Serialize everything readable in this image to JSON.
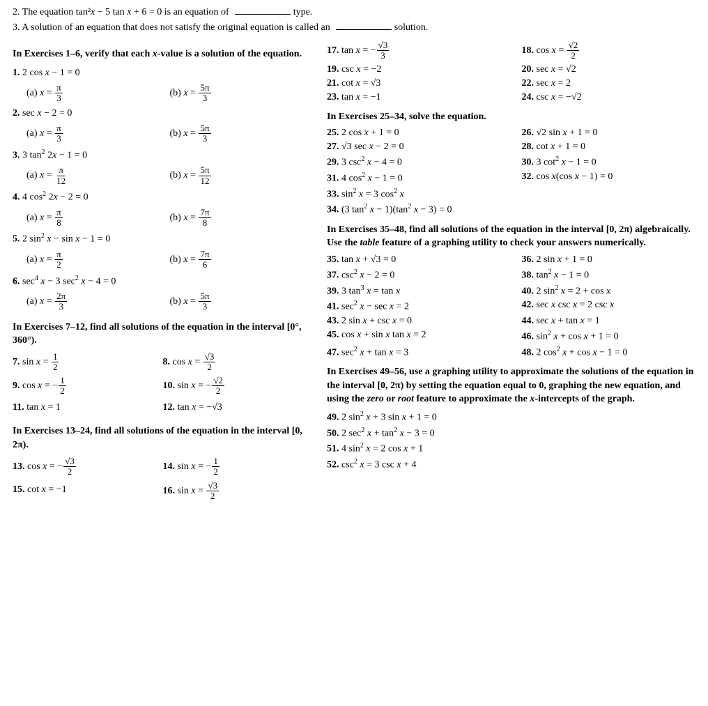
{
  "page": {
    "top": {
      "line2": "2. The equation tan²x − 5 tan x + 6 = 0 is an equation of",
      "line2_blank": "",
      "line2_type": "type.",
      "line3": "3. A solution of an equation that does not satisfy the original equation is called an",
      "line3_blank": "",
      "line3_end": "solution."
    },
    "sections": {
      "verify_header": "In Exercises 1–6, verify that each x-value is a solution of the equation.",
      "interval_7_12_header": "In Exercises 7–12, find all solutions of the equation in the interval [0°, 360°).",
      "interval_13_24_header": "In Exercises 13–24, find all solutions of the equation in the interval [0, 2π).",
      "right_17_24_header": "",
      "exercises_25_34_header": "In Exercises 25–34, solve the equation.",
      "exercises_35_48_header": "In Exercises 35–48, find all solutions of the equation in the interval [0, 2π) algebraically. Use the table feature of a graphing utility to check your answers numerically.",
      "exercises_49_56_header": "In Exercises 49–56, use a graphing utility to approximate the solutions of the equation in the interval [0, 2π) by setting the equation equal to 0, graphing the new equation, and using the zero or root feature to approximate the x-intercepts of the graph."
    }
  }
}
